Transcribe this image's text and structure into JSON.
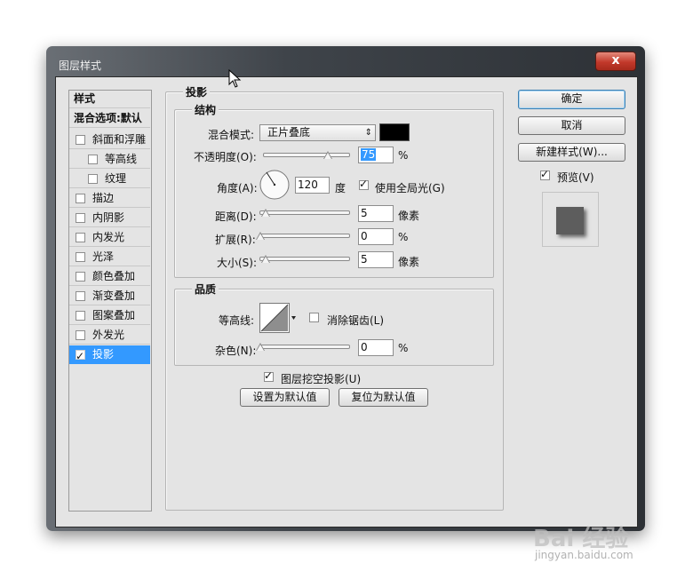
{
  "window": {
    "title": "图层样式",
    "close": "x"
  },
  "styles_list": {
    "header": "样式",
    "blend_options": "混合选项:默认",
    "items": [
      {
        "label": "斜面和浮雕",
        "checked": false
      },
      {
        "label": "等高线",
        "checked": false
      },
      {
        "label": "纹理",
        "checked": false
      },
      {
        "label": "描边",
        "checked": false
      },
      {
        "label": "内阴影",
        "checked": false
      },
      {
        "label": "内发光",
        "checked": false
      },
      {
        "label": "光泽",
        "checked": false
      },
      {
        "label": "颜色叠加",
        "checked": false
      },
      {
        "label": "渐变叠加",
        "checked": false
      },
      {
        "label": "图案叠加",
        "checked": false
      },
      {
        "label": "外发光",
        "checked": false
      },
      {
        "label": "投影",
        "checked": true,
        "selected": true
      }
    ]
  },
  "panel": {
    "section_title": "投影",
    "structure": {
      "title": "结构",
      "blend_mode_label": "混合模式:",
      "blend_mode_value": "正片叠底",
      "blend_color": "#000000",
      "opacity_label": "不透明度(O):",
      "opacity_value": "75",
      "opacity_unit": "%",
      "angle_label": "角度(A):",
      "angle_value": "120",
      "angle_unit": "度",
      "global_light_label": "使用全局光(G)",
      "global_light_checked": true,
      "distance_label": "距离(D):",
      "distance_value": "5",
      "distance_unit": "像素",
      "spread_label": "扩展(R):",
      "spread_value": "0",
      "spread_unit": "%",
      "size_label": "大小(S):",
      "size_value": "5",
      "size_unit": "像素"
    },
    "quality": {
      "title": "品质",
      "contour_label": "等高线:",
      "anti_alias_label": "消除锯齿(L)",
      "anti_alias_checked": false,
      "noise_label": "杂色(N):",
      "noise_value": "0",
      "noise_unit": "%"
    },
    "knockout_label": "图层挖空投影(U)",
    "knockout_checked": true,
    "make_default": "设置为默认值",
    "reset_default": "复位为默认值"
  },
  "buttons": {
    "ok": "确定",
    "cancel": "取消",
    "new_style": "新建样式(W)...",
    "preview_label": "预览(V)",
    "preview_checked": true
  },
  "watermark": {
    "brand": "Bai 经验",
    "url": "jingyan.baidu.com"
  }
}
